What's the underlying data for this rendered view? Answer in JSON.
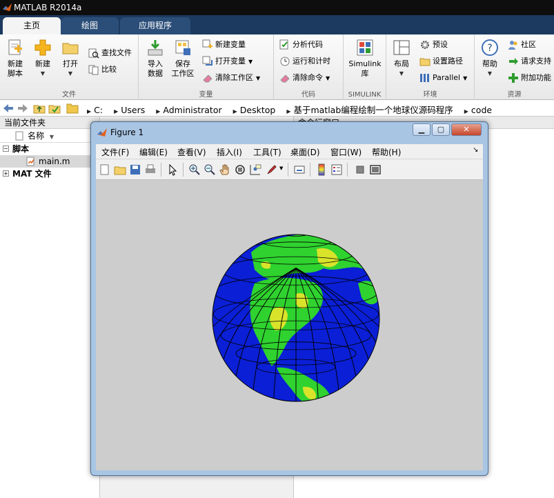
{
  "app": {
    "title": "MATLAB R2014a",
    "accent": "#1c3a5f"
  },
  "ribbon_tabs": [
    {
      "label": "主页",
      "active": true
    },
    {
      "label": "绘图",
      "active": false
    },
    {
      "label": "应用程序",
      "active": false
    }
  ],
  "ribbon": {
    "file_group": {
      "label": "文件",
      "new_script": "新建\n脚本",
      "new": "新建",
      "open": "打开",
      "find_files": "查找文件",
      "compare": "比较"
    },
    "variable_group": {
      "label": "变量",
      "import_data": "导入\n数据",
      "save_workspace": "保存\n工作区",
      "new_variable": "新建变量",
      "open_variable": "打开变量",
      "clear_workspace": "清除工作区"
    },
    "code_group": {
      "label": "代码",
      "analyze_code": "分析代码",
      "run_and_time": "运行和计时",
      "clear_commands": "清除命令"
    },
    "simulink_group": {
      "label": "SIMULINK",
      "simulink_library": "Simulink\n库"
    },
    "environment_group": {
      "label": "环境",
      "layout": "布局",
      "preferences": "预设",
      "set_path": "设置路径",
      "parallel": "Parallel"
    },
    "resources_group": {
      "label": "资源",
      "help": "帮助",
      "community": "社区",
      "request_support": "请求支持",
      "add_ons": "附加功能"
    }
  },
  "address_bar": {
    "path": [
      "C:",
      "Users",
      "Administrator",
      "Desktop",
      "基于matlab编程绘制一个地球仪源码程序",
      "code"
    ]
  },
  "current_folder": {
    "title": "当前文件夹",
    "column_name": "名称",
    "groups": [
      {
        "label": "脚本",
        "expanded": true,
        "items": [
          "main.m"
        ]
      },
      {
        "label": "MAT 文件",
        "expanded": false,
        "items": []
      }
    ]
  },
  "command_window": {
    "title": "命令行窗口"
  },
  "figure": {
    "title": "Figure 1",
    "menus": [
      "文件(F)",
      "编辑(E)",
      "查看(V)",
      "插入(I)",
      "工具(T)",
      "桌面(D)",
      "窗口(W)",
      "帮助(H)"
    ],
    "toolbar_icons": [
      "new-figure-icon",
      "open-file-icon",
      "save-icon",
      "print-icon",
      "edit-plot-arrow-icon",
      "zoom-in-icon",
      "zoom-out-icon",
      "pan-hand-icon",
      "rotate-3d-icon",
      "data-cursor-icon",
      "brush-icon",
      "link-plot-icon",
      "colorbar-icon",
      "legend-icon",
      "hide-plot-tools-icon",
      "show-plot-tools-icon"
    ],
    "globe_colors": {
      "ocean": "#0a1fd6",
      "land_green": "#2fd22f",
      "land_yellow": "#d8e32a",
      "grid": "#000000"
    }
  }
}
